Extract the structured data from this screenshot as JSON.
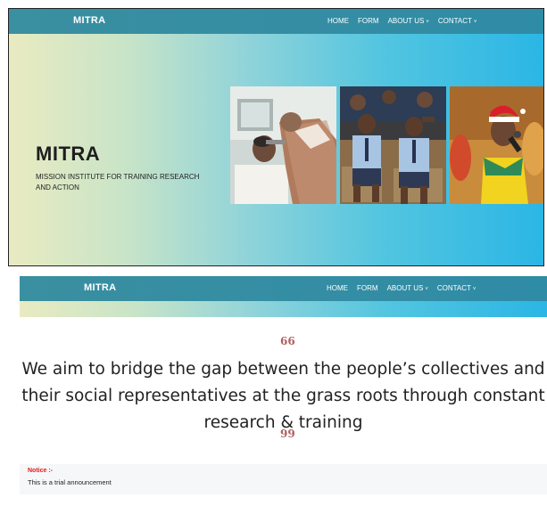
{
  "brand": "MITRA",
  "nav": {
    "home": "HOME",
    "form": "FORM",
    "about": "ABOUT US",
    "contact": "CONTACT",
    "dropdown_caret": "˅"
  },
  "hero": {
    "title": "MITRA",
    "subtitle": "MISSION INSTITUTE FOR TRAINING RESEARCH AND ACTION"
  },
  "mission": {
    "open_quote": "66",
    "text": "We aim to bridge the gap between the people’s collectives and their social representatives at the grass roots through constant research & training",
    "close_quote": "99"
  },
  "notice": {
    "label": "Notice :-",
    "text": "This is a trial announcement"
  },
  "colors": {
    "navbar": "#3a8fa0",
    "hero_left": "#e9ebc1",
    "hero_right": "#2bb6e5",
    "notice_label": "#e01b1b"
  }
}
